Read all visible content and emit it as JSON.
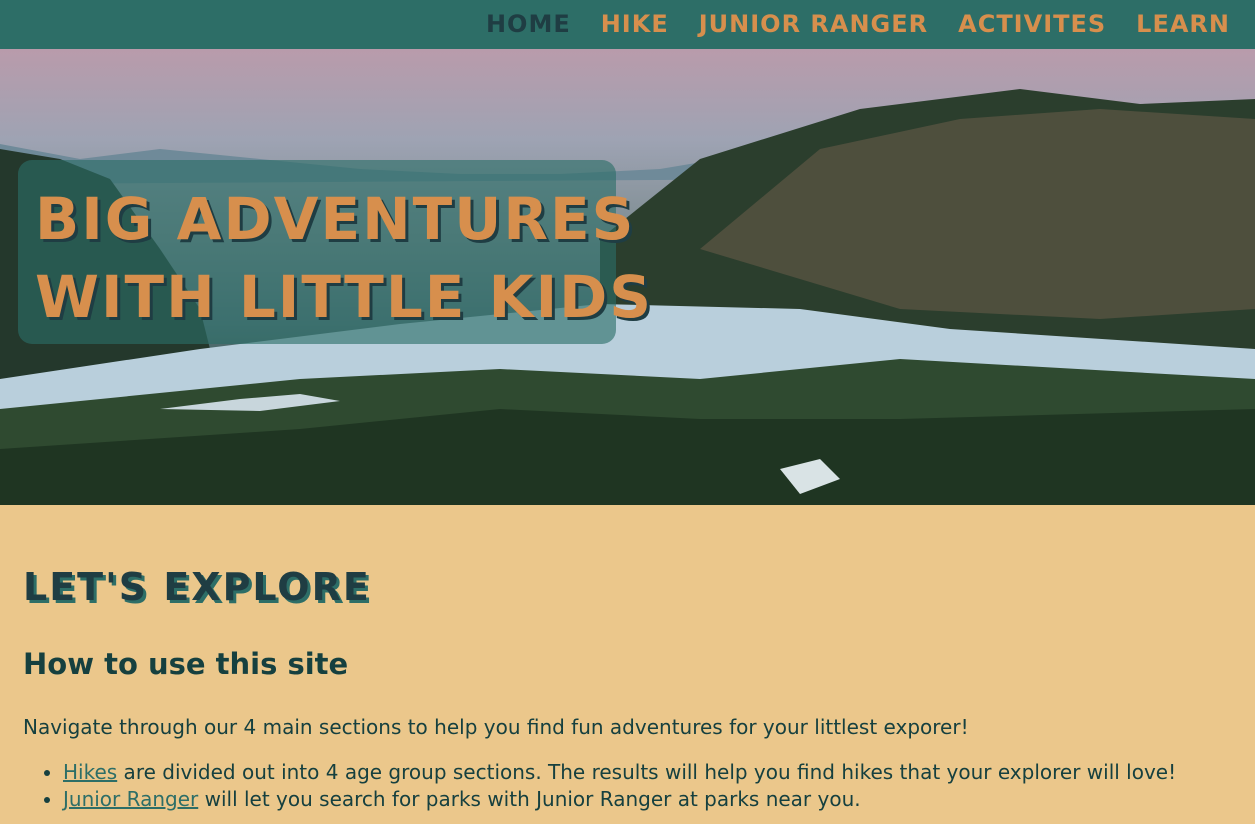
{
  "nav": {
    "items": [
      {
        "label": "Home",
        "active": true
      },
      {
        "label": "Hike",
        "active": false
      },
      {
        "label": "Junior Ranger",
        "active": false
      },
      {
        "label": "Activites",
        "active": false
      },
      {
        "label": "Learn",
        "active": false
      }
    ]
  },
  "hero": {
    "line1": "Big Adventures",
    "line2": "with Little Kids"
  },
  "main": {
    "heading": "Let's Explore",
    "subheading": "How to use this site",
    "intro": "Navigate through our 4 main sections to help you find fun adventures for your littlest exporer!",
    "bullets": [
      {
        "link": "Hikes",
        "text": " are divided out into 4 age group sections. The results will help you find hikes that your explorer will love!"
      },
      {
        "link": "Junior Ranger",
        "text": " will let you search for parks with Junior Ranger at parks near you."
      }
    ]
  },
  "colors": {
    "nav_bg": "#2d6e67",
    "accent": "#d78f4d",
    "page_bg": "#ebc78b",
    "text": "#16403f"
  }
}
